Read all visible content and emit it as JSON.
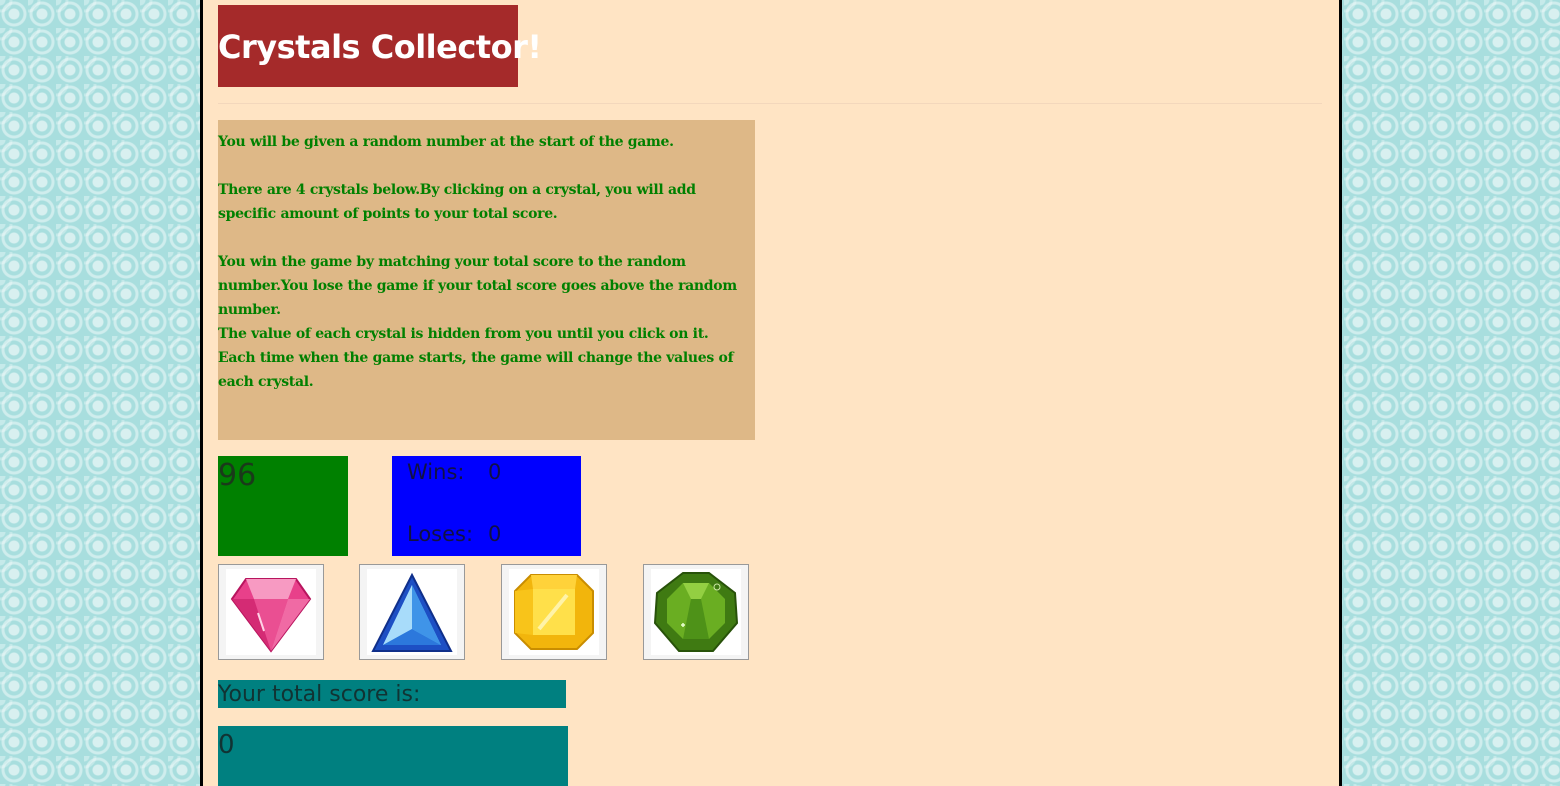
{
  "header": {
    "title": "Crystals Collector!"
  },
  "instructions": {
    "paragraphs": [
      "You will be given a random number at the start of the game.",
      "There are 4 crystals below.By clicking on a crystal, you will add specific amount of points to your total score.",
      "You win the game by matching your total score to the random number.You lose the game if your total score goes above the random number.",
      "The value of each crystal is hidden from you until you click on it. Each time when the game starts, the game will change the values of each crystal."
    ]
  },
  "game": {
    "target_number": "96",
    "wins_label": "Wins:",
    "wins_value": "0",
    "loses_label": "Loses:",
    "loses_value": "0",
    "score_label": "Your total score is:",
    "score_value": "0"
  },
  "crystals": [
    {
      "icon": "pink-crystal-icon",
      "color": "#e8408a"
    },
    {
      "icon": "blue-crystal-icon",
      "color": "#2a6ee0"
    },
    {
      "icon": "yellow-crystal-icon",
      "color": "#f2c623"
    },
    {
      "icon": "green-crystal-icon",
      "color": "#4f8f1a"
    }
  ],
  "colors": {
    "page_background": "#ffe4c4",
    "title_background": "#a52a2a",
    "instructions_background": "#deb887",
    "instructions_text": "#008000",
    "target_background": "#008000",
    "stats_background": "#0000ff",
    "score_background": "#008080"
  }
}
